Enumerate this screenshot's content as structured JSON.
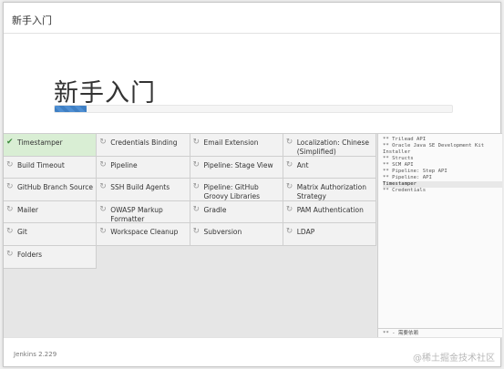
{
  "window": {
    "title": "新手入门"
  },
  "hero": {
    "title": "新手入门",
    "progress": 0.08
  },
  "plugins": [
    {
      "label": "Timestamper",
      "status": "installed",
      "icon": "checkmark-icon"
    },
    {
      "label": "Credentials Binding",
      "status": "pending",
      "icon": "refresh-icon"
    },
    {
      "label": "Email Extension",
      "status": "pending",
      "icon": "refresh-icon"
    },
    {
      "label": "Localization: Chinese (Simplified)",
      "status": "pending",
      "icon": "refresh-icon"
    },
    {
      "label": "Build Timeout",
      "status": "pending",
      "icon": "refresh-icon"
    },
    {
      "label": "Pipeline",
      "status": "pending",
      "icon": "refresh-icon"
    },
    {
      "label": "Pipeline: Stage View",
      "status": "pending",
      "icon": "refresh-icon"
    },
    {
      "label": "Ant",
      "status": "pending",
      "icon": "refresh-icon"
    },
    {
      "label": "GitHub Branch Source",
      "status": "pending",
      "icon": "refresh-icon"
    },
    {
      "label": "SSH Build Agents",
      "status": "pending",
      "icon": "refresh-icon"
    },
    {
      "label": "Pipeline: GitHub Groovy Libraries",
      "status": "pending",
      "icon": "refresh-icon"
    },
    {
      "label": "Matrix Authorization Strategy",
      "status": "pending",
      "icon": "refresh-icon"
    },
    {
      "label": "Mailer",
      "status": "pending",
      "icon": "refresh-icon"
    },
    {
      "label": "OWASP Markup Formatter",
      "status": "pending",
      "icon": "refresh-icon"
    },
    {
      "label": "Gradle",
      "status": "pending",
      "icon": "refresh-icon"
    },
    {
      "label": "PAM Authentication",
      "status": "pending",
      "icon": "refresh-icon"
    },
    {
      "label": "Git",
      "status": "pending",
      "icon": "refresh-icon"
    },
    {
      "label": "Workspace Cleanup",
      "status": "pending",
      "icon": "refresh-icon"
    },
    {
      "label": "Subversion",
      "status": "pending",
      "icon": "refresh-icon"
    },
    {
      "label": "LDAP",
      "status": "pending",
      "icon": "refresh-icon"
    },
    {
      "label": "Folders",
      "status": "pending",
      "icon": "refresh-icon"
    }
  ],
  "log": {
    "lines": [
      {
        "text": "** Trilead API",
        "highlight": false
      },
      {
        "text": "** Oracle Java SE Development Kit Installer",
        "highlight": false
      },
      {
        "text": "** Structs",
        "highlight": false
      },
      {
        "text": "** SCM API",
        "highlight": false
      },
      {
        "text": "** Pipeline: Step API",
        "highlight": false
      },
      {
        "text": "** Pipeline: API",
        "highlight": false
      },
      {
        "text": "Timestamper",
        "highlight": true
      },
      {
        "text": "** Credentials",
        "highlight": false
      }
    ],
    "footnote": "** - 需要依赖"
  },
  "footer": {
    "version": "Jenkins 2.229",
    "watermark": "@稀土掘金技术社区"
  }
}
